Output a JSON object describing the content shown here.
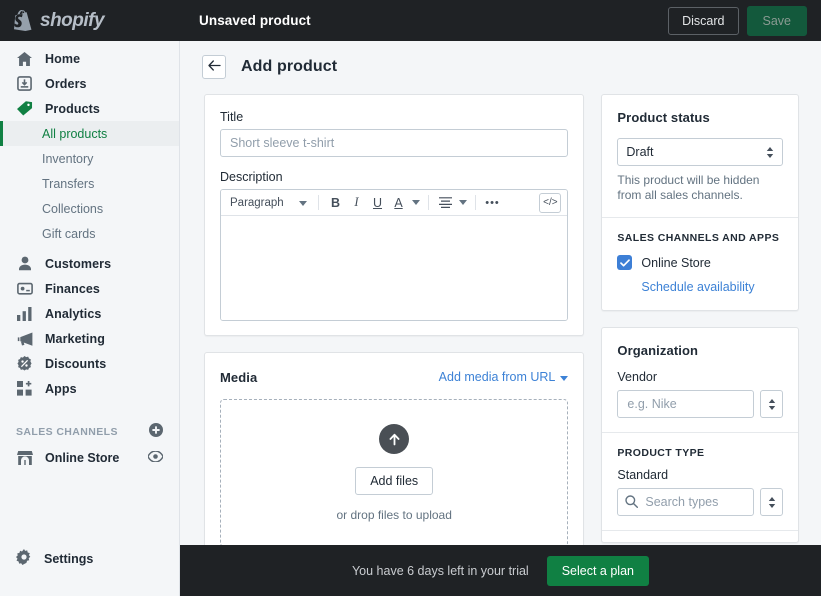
{
  "topbar": {
    "brand": "shopify",
    "brand_icon": "shopify-bag-icon",
    "title": "Unsaved product",
    "discard_label": "Discard",
    "save_label": "Save"
  },
  "sidebar": {
    "items": [
      {
        "label": "Home",
        "icon": "home-icon"
      },
      {
        "label": "Orders",
        "icon": "orders-inbox-icon"
      },
      {
        "label": "Products",
        "icon": "products-tag-icon"
      }
    ],
    "subitems": [
      {
        "label": "All products",
        "active": true
      },
      {
        "label": "Inventory",
        "active": false
      },
      {
        "label": "Transfers",
        "active": false
      },
      {
        "label": "Collections",
        "active": false
      },
      {
        "label": "Gift cards",
        "active": false
      }
    ],
    "items2": [
      {
        "label": "Customers",
        "icon": "customers-person-icon"
      },
      {
        "label": "Finances",
        "icon": "finances-card-icon"
      },
      {
        "label": "Analytics",
        "icon": "analytics-bars-icon"
      },
      {
        "label": "Marketing",
        "icon": "marketing-megaphone-icon"
      },
      {
        "label": "Discounts",
        "icon": "discounts-percent-icon"
      },
      {
        "label": "Apps",
        "icon": "apps-grid-plus-icon"
      }
    ],
    "sales_channels_heading": "SALES CHANNELS",
    "add_channel_icon": "plus-circle-icon",
    "channels": [
      {
        "label": "Online Store",
        "icon": "storefront-icon",
        "action_icon": "eye-icon"
      }
    ],
    "settings": {
      "label": "Settings",
      "icon": "gear-icon"
    }
  },
  "page": {
    "back_icon": "arrow-left-icon",
    "title": "Add product"
  },
  "product_form": {
    "title_label": "Title",
    "title_value": "",
    "title_placeholder": "Short sleeve t-shirt",
    "description_label": "Description",
    "toolbar": {
      "block_format": "Paragraph",
      "block_caret_icon": "chevron-down-icon",
      "bold": "B",
      "bold_icon": "bold-icon",
      "italic": "I",
      "italic_icon": "italic-icon",
      "underline": "U",
      "underline_icon": "underline-icon",
      "text_color": "A",
      "text_color_icon": "text-color-icon",
      "color_caret_icon": "chevron-down-icon",
      "align_icon": "align-icon",
      "align_caret_icon": "chevron-down-icon",
      "more_icon": "ellipsis-icon",
      "more": "•••",
      "code_view": "</>",
      "code_view_icon": "code-view-icon"
    },
    "description_value": ""
  },
  "media": {
    "title": "Media",
    "add_from_url": "Add media from URL",
    "add_from_url_caret_icon": "chevron-down-icon",
    "upload_icon": "upload-arrow-icon",
    "add_files_label": "Add files",
    "drop_hint": "or drop files to upload"
  },
  "product_status": {
    "title": "Product status",
    "status_value": "Draft",
    "status_stepper_icon": "stepper-arrows-icon",
    "helper": "This product will be hidden from all sales channels.",
    "channels_heading": "SALES CHANNELS AND APPS",
    "online_store_label": "Online Store",
    "online_store_checked": true,
    "check_icon": "checkmark-icon",
    "schedule_link": "Schedule availability"
  },
  "organization": {
    "title": "Organization",
    "vendor_label": "Vendor",
    "vendor_value": "",
    "vendor_placeholder": "e.g. Nike",
    "vendor_stepper_icon": "stepper-arrows-icon",
    "product_type_heading": "PRODUCT TYPE",
    "standard_label": "Standard",
    "search_icon": "search-icon",
    "search_value": "",
    "search_placeholder": "Search types",
    "search_stepper_icon": "stepper-arrows-icon"
  },
  "trial": {
    "message": "You have 6 days left in your trial",
    "cta_label": "Select a plan"
  },
  "colors": {
    "brand_green": "#108043",
    "accent_blue": "#3d82d6",
    "dark_bg": "#1f2225",
    "page_bg": "#f4f6f8"
  }
}
